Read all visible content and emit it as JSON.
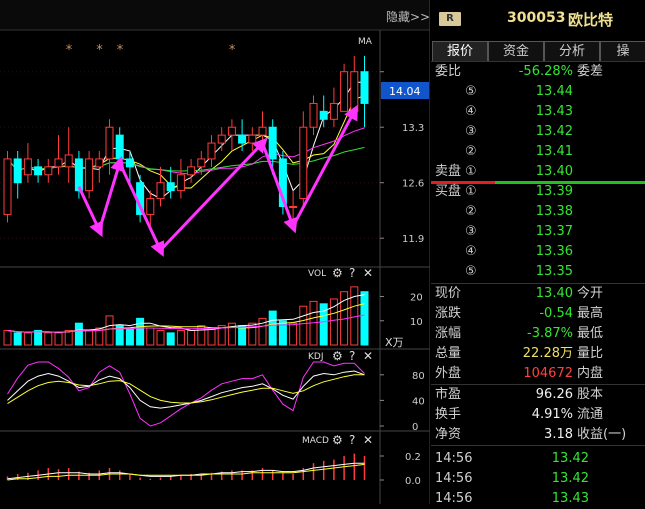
{
  "top_bar": {
    "hide_label": "隐藏>>"
  },
  "header": {
    "badge": "R",
    "code": "300053",
    "name": "欧比特"
  },
  "tabs": [
    {
      "label": "报价"
    },
    {
      "label": "资金"
    },
    {
      "label": "分析"
    },
    {
      "label": "操"
    }
  ],
  "weibi": {
    "label": "委比",
    "value": "-56.28%",
    "label2": "委差"
  },
  "sell": [
    {
      "label": "",
      "num": "⑤",
      "price": "13.44"
    },
    {
      "label": "",
      "num": "④",
      "price": "13.43"
    },
    {
      "label": "",
      "num": "③",
      "price": "13.42"
    },
    {
      "label": "",
      "num": "②",
      "price": "13.41"
    },
    {
      "label": "卖盘",
      "num": "①",
      "price": "13.40"
    }
  ],
  "buy": [
    {
      "label": "买盘",
      "num": "①",
      "price": "13.39"
    },
    {
      "label": "",
      "num": "②",
      "price": "13.38"
    },
    {
      "label": "",
      "num": "③",
      "price": "13.37"
    },
    {
      "label": "",
      "num": "④",
      "price": "13.36"
    },
    {
      "label": "",
      "num": "⑤",
      "price": "13.35"
    }
  ],
  "stats1": [
    {
      "label": "现价",
      "value": "13.40",
      "label2": "今开",
      "color": "g"
    },
    {
      "label": "涨跌",
      "value": "-0.54",
      "label2": "最高",
      "color": "g"
    },
    {
      "label": "涨幅",
      "value": "-3.87%",
      "label2": "最低",
      "color": "g"
    },
    {
      "label": "总量",
      "value": "22.28万",
      "label2": "量比",
      "color": "y"
    },
    {
      "label": "外盘",
      "value": "104672",
      "label2": "内盘",
      "color": "r"
    }
  ],
  "stats2": [
    {
      "label": "市盈",
      "value": "96.26",
      "label2": "股本",
      "color": "w"
    },
    {
      "label": "换手",
      "value": "4.91%",
      "label2": "流通",
      "color": "w"
    },
    {
      "label": "净资",
      "value": "3.18",
      "label2": "收益(一)",
      "color": "w"
    }
  ],
  "ticks": [
    {
      "time": "14:56",
      "price": "13.42"
    },
    {
      "time": "14:56",
      "price": "13.42"
    },
    {
      "time": "14:56",
      "price": "13.43"
    }
  ],
  "chart_data": {
    "type": "candlestick",
    "main_label": "MA",
    "price_axis": [
      "14.0",
      "13.3",
      "12.6",
      "11.9"
    ],
    "current_price_tag": "14.04",
    "stars": [
      "*",
      "*",
      "*",
      "*"
    ],
    "vol": {
      "label": "VOL",
      "axis": [
        "20",
        "10"
      ],
      "unit": "X万"
    },
    "kdj": {
      "label": "KDJ",
      "axis": [
        "80",
        "40",
        "0"
      ]
    },
    "macd": {
      "label": "MACD",
      "axis": [
        "0.2",
        "0.0"
      ]
    },
    "candles": [
      {
        "o": 12.2,
        "c": 12.9,
        "h": 13.0,
        "l": 12.1
      },
      {
        "o": 12.9,
        "c": 12.6,
        "h": 13.0,
        "l": 12.4
      },
      {
        "o": 12.7,
        "c": 12.9,
        "h": 13.1,
        "l": 12.6
      },
      {
        "o": 12.8,
        "c": 12.7,
        "h": 12.9,
        "l": 12.6
      },
      {
        "o": 12.7,
        "c": 12.8,
        "h": 12.9,
        "l": 12.6
      },
      {
        "o": 12.8,
        "c": 12.9,
        "h": 13.2,
        "l": 12.7
      },
      {
        "o": 12.8,
        "c": 12.95,
        "h": 13.3,
        "l": 12.6
      },
      {
        "o": 12.9,
        "c": 12.5,
        "h": 13.0,
        "l": 12.4
      },
      {
        "o": 12.5,
        "c": 12.9,
        "h": 13.0,
        "l": 12.4
      },
      {
        "o": 12.8,
        "c": 12.9,
        "h": 13.0,
        "l": 12.6
      },
      {
        "o": 12.9,
        "c": 13.3,
        "h": 13.4,
        "l": 12.7
      },
      {
        "o": 13.2,
        "c": 12.9,
        "h": 13.3,
        "l": 12.8
      },
      {
        "o": 12.9,
        "c": 12.8,
        "h": 13.0,
        "l": 12.6
      },
      {
        "o": 12.6,
        "c": 12.2,
        "h": 12.7,
        "l": 12.1
      },
      {
        "o": 12.2,
        "c": 12.4,
        "h": 12.5,
        "l": 12.0
      },
      {
        "o": 12.4,
        "c": 12.6,
        "h": 12.8,
        "l": 12.3
      },
      {
        "o": 12.6,
        "c": 12.5,
        "h": 12.8,
        "l": 12.4
      },
      {
        "o": 12.5,
        "c": 12.7,
        "h": 12.9,
        "l": 12.4
      },
      {
        "o": 12.7,
        "c": 12.8,
        "h": 12.9,
        "l": 12.6
      },
      {
        "o": 12.8,
        "c": 12.9,
        "h": 13.0,
        "l": 12.7
      },
      {
        "o": 12.9,
        "c": 13.1,
        "h": 13.2,
        "l": 12.8
      },
      {
        "o": 13.1,
        "c": 13.2,
        "h": 13.3,
        "l": 13.0
      },
      {
        "o": 13.2,
        "c": 13.3,
        "h": 13.4,
        "l": 13.0
      },
      {
        "o": 13.2,
        "c": 13.1,
        "h": 13.4,
        "l": 13.0
      },
      {
        "o": 13.1,
        "c": 13.2,
        "h": 13.3,
        "l": 13.0
      },
      {
        "o": 13.2,
        "c": 13.3,
        "h": 13.5,
        "l": 13.1
      },
      {
        "o": 13.3,
        "c": 12.9,
        "h": 13.4,
        "l": 12.7
      },
      {
        "o": 12.9,
        "c": 12.3,
        "h": 13.0,
        "l": 12.2
      },
      {
        "o": 12.3,
        "c": 12.3,
        "h": 12.5,
        "l": 12.0
      },
      {
        "o": 12.4,
        "c": 13.3,
        "h": 13.5,
        "l": 12.3
      },
      {
        "o": 13.3,
        "c": 13.6,
        "h": 13.7,
        "l": 13.2
      },
      {
        "o": 13.5,
        "c": 13.4,
        "h": 13.7,
        "l": 13.3
      },
      {
        "o": 13.4,
        "c": 13.6,
        "h": 13.8,
        "l": 13.3
      },
      {
        "o": 13.5,
        "c": 14.0,
        "h": 14.1,
        "l": 13.5
      },
      {
        "o": 13.5,
        "c": 14.0,
        "h": 14.2,
        "l": 13.4
      },
      {
        "o": 14.0,
        "c": 13.6,
        "h": 14.2,
        "l": 13.3
      }
    ],
    "vol_values": [
      6,
      5,
      5,
      6,
      5,
      5,
      6,
      9,
      6,
      7,
      12,
      8,
      7,
      11,
      7,
      6,
      5,
      6,
      6,
      8,
      7,
      8,
      9,
      8,
      9,
      11,
      14,
      10,
      9,
      16,
      18,
      17,
      19,
      22,
      24,
      22
    ],
    "kdj_k": [
      40,
      55,
      70,
      78,
      82,
      78,
      70,
      60,
      62,
      72,
      78,
      74,
      60,
      40,
      30,
      28,
      30,
      33,
      36,
      40,
      46,
      52,
      56,
      60,
      62,
      66,
      58,
      48,
      42,
      62,
      78,
      82,
      80,
      84,
      86,
      80
    ],
    "kdj_d": [
      35,
      45,
      55,
      63,
      68,
      70,
      68,
      64,
      63,
      66,
      70,
      71,
      66,
      56,
      46,
      40,
      37,
      36,
      36,
      38,
      41,
      45,
      49,
      53,
      56,
      59,
      59,
      55,
      51,
      55,
      63,
      69,
      73,
      77,
      80,
      80
    ],
    "kdj_j": [
      50,
      75,
      95,
      100,
      100,
      90,
      76,
      55,
      60,
      84,
      94,
      84,
      50,
      12,
      0,
      5,
      16,
      27,
      36,
      44,
      56,
      66,
      70,
      74,
      74,
      80,
      56,
      34,
      24,
      76,
      100,
      100,
      94,
      98,
      98,
      82
    ],
    "macd_bars": [
      0.03,
      0.05,
      0.06,
      0.08,
      0.1,
      0.09,
      0.1,
      0.07,
      0.06,
      0.08,
      0.1,
      0.08,
      0.05,
      0.02,
      0.01,
      0.02,
      0.03,
      0.04,
      0.05,
      0.05,
      0.06,
      0.07,
      0.08,
      0.08,
      0.08,
      0.1,
      0.08,
      0.06,
      0.05,
      0.1,
      0.14,
      0.16,
      0.17,
      0.2,
      0.22,
      0.2
    ],
    "macd_dif": [
      0.01,
      0.02,
      0.03,
      0.04,
      0.05,
      0.06,
      0.06,
      0.06,
      0.05,
      0.05,
      0.06,
      0.06,
      0.05,
      0.04,
      0.03,
      0.03,
      0.03,
      0.04,
      0.04,
      0.05,
      0.05,
      0.06,
      0.06,
      0.07,
      0.07,
      0.08,
      0.08,
      0.07,
      0.07,
      0.08,
      0.1,
      0.11,
      0.12,
      0.13,
      0.14,
      0.14
    ],
    "macd_dea": [
      0.0,
      0.01,
      0.01,
      0.02,
      0.03,
      0.03,
      0.04,
      0.04,
      0.04,
      0.04,
      0.05,
      0.05,
      0.05,
      0.04,
      0.04,
      0.04,
      0.04,
      0.04,
      0.04,
      0.04,
      0.05,
      0.05,
      0.05,
      0.05,
      0.06,
      0.06,
      0.06,
      0.06,
      0.06,
      0.07,
      0.08,
      0.09,
      0.1,
      0.11,
      0.12,
      0.13
    ]
  },
  "colors": {
    "up": "#ff3b3b",
    "down": "#00ffff",
    "arrow": "#ff33ff",
    "ma_white": "#ffffff",
    "ma_yellow": "#ffff33",
    "ma_magenta": "#ff33ff",
    "ma_green": "#33dd33",
    "blue_tag": "#1155cc"
  }
}
